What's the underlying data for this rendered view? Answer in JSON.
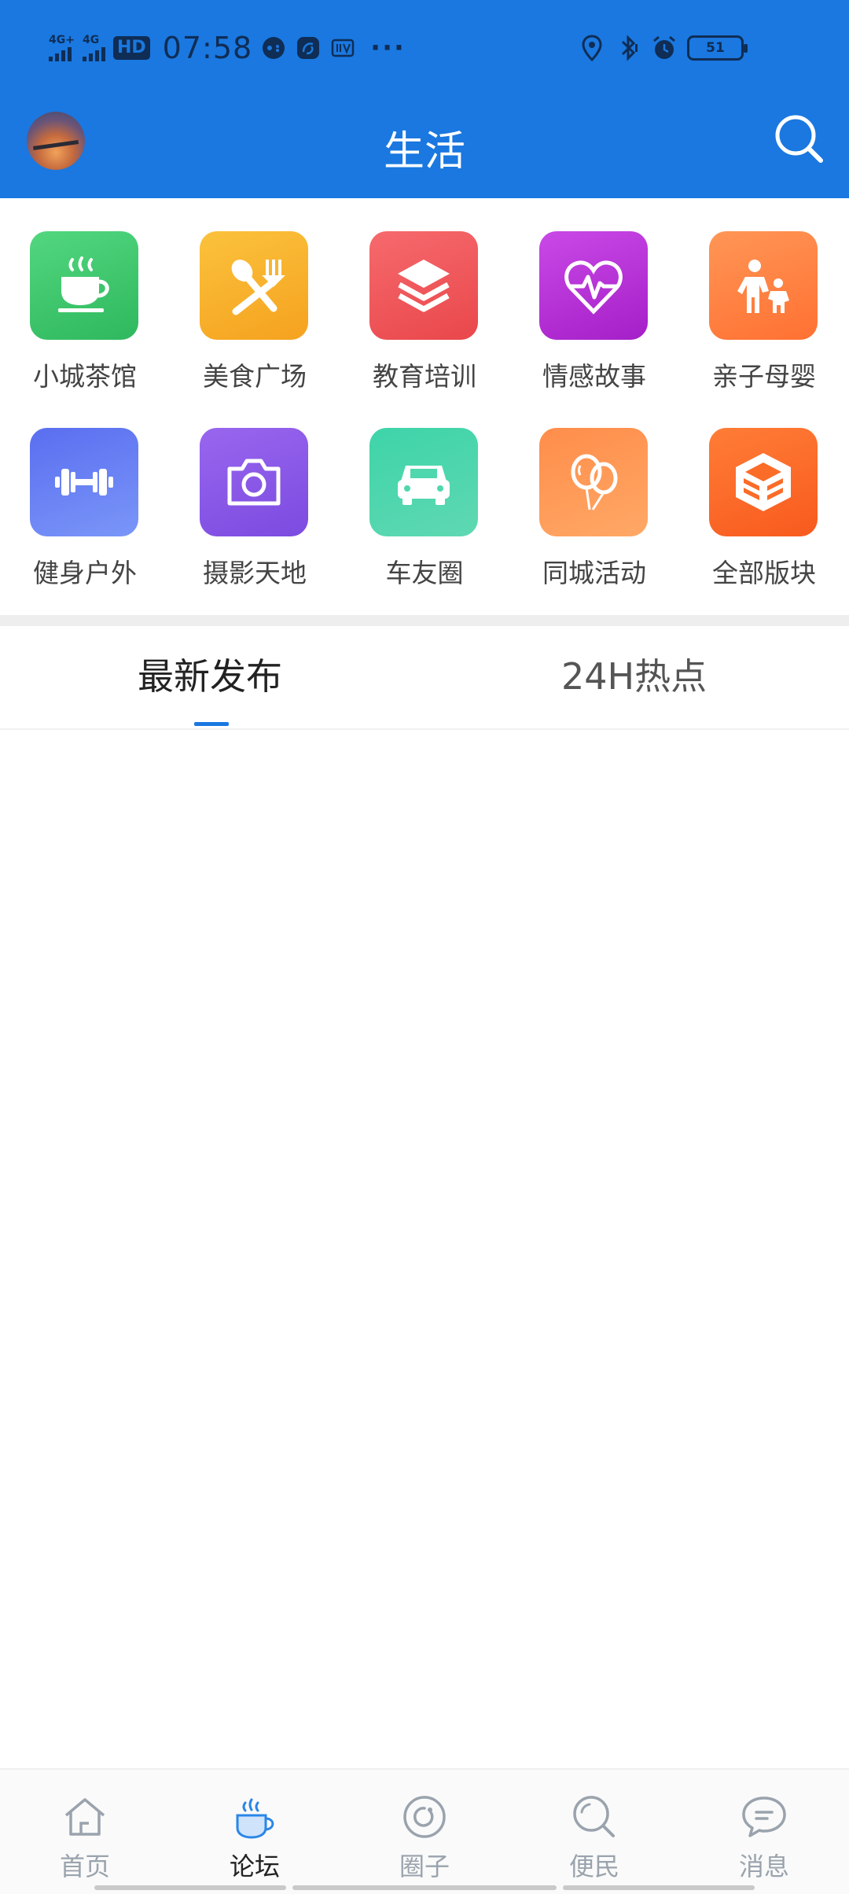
{
  "status_bar": {
    "signal_1": "4G+",
    "signal_2": "4G",
    "hd_badge": "HD",
    "time": "07:58",
    "more": "···",
    "battery": "51"
  },
  "header": {
    "title": "生活"
  },
  "categories": [
    {
      "label": "小城茶馆",
      "icon": "tea-cup-icon",
      "color": "#3cc46a"
    },
    {
      "label": "美食广场",
      "icon": "fork-spoon-icon",
      "color": "#f7b22a"
    },
    {
      "label": "教育培训",
      "icon": "layers-icon",
      "color": "#f05a5e"
    },
    {
      "label": "情感故事",
      "icon": "heart-pulse-icon",
      "color": "#b72ed6"
    },
    {
      "label": "亲子母婴",
      "icon": "parent-child-icon",
      "color": "#ff7e43"
    },
    {
      "label": "健身户外",
      "icon": "dumbbell-icon",
      "color": "#5c72f2"
    },
    {
      "label": "摄影天地",
      "icon": "camera-icon",
      "color": "#8a55e8"
    },
    {
      "label": "车友圈",
      "icon": "car-icon",
      "color": "#3dcca5"
    },
    {
      "label": "同城活动",
      "icon": "balloons-icon",
      "color": "#ff8a45"
    },
    {
      "label": "全部版块",
      "icon": "cube-icon",
      "color": "#ff6b2a"
    }
  ],
  "tabs": [
    {
      "label": "最新发布",
      "active": true
    },
    {
      "label": "24H热点",
      "active": false
    }
  ],
  "bottom_nav": [
    {
      "label": "首页",
      "icon": "home-icon",
      "active": false
    },
    {
      "label": "论坛",
      "icon": "forum-cup-icon",
      "active": true
    },
    {
      "label": "圈子",
      "icon": "circle-icon",
      "active": false
    },
    {
      "label": "便民",
      "icon": "magnifier-icon",
      "active": false
    },
    {
      "label": "消息",
      "icon": "message-icon",
      "active": false
    }
  ],
  "colors": {
    "brand_blue": "#1a78e0",
    "tab_indicator": "#1a78e0"
  }
}
